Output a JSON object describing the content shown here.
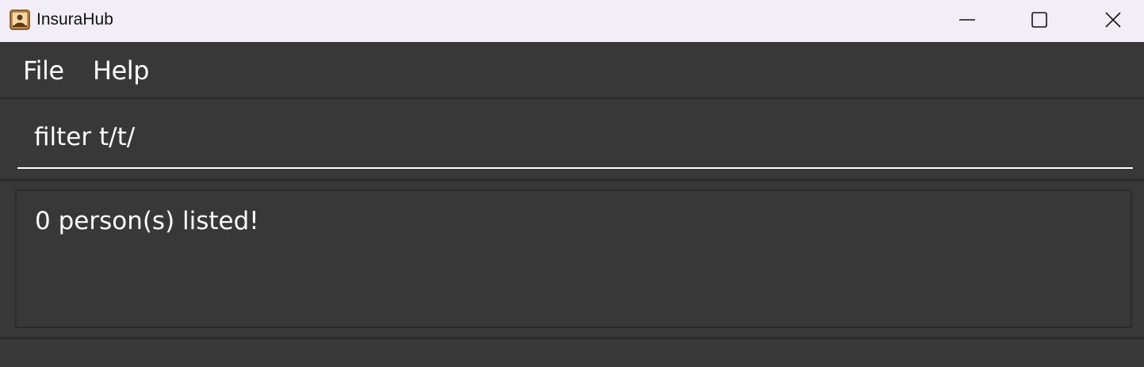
{
  "window": {
    "title": "InsuraHub",
    "controls": {
      "minimize_icon": "minimize-icon",
      "maximize_icon": "maximize-icon",
      "close_icon": "close-icon"
    }
  },
  "menu": {
    "items": [
      {
        "label": "File"
      },
      {
        "label": "Help"
      }
    ]
  },
  "command_box": {
    "value": "filter t/t/"
  },
  "result_display": {
    "message": "0 person(s) listed!"
  },
  "colors": {
    "titlebar_bg": "#f2eef7",
    "app_bg": "#383838",
    "text": "#ffffff",
    "separator": "#2c2c2c"
  }
}
